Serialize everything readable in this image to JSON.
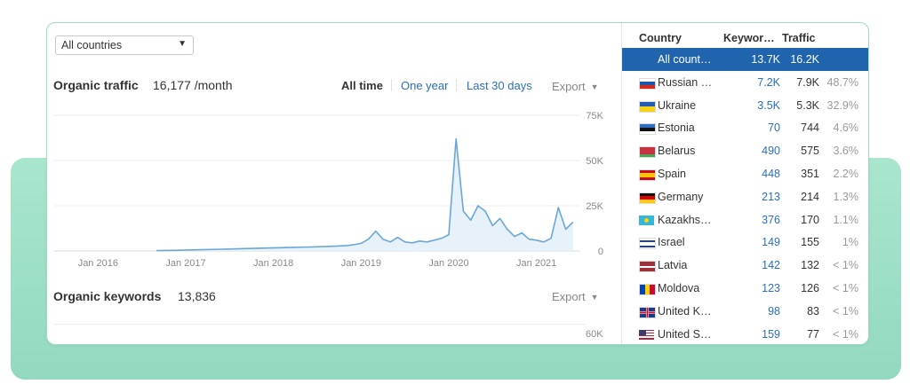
{
  "filter": {
    "country_select": "All countries"
  },
  "organic_traffic": {
    "title": "Organic traffic",
    "value": "16,177 /month",
    "ranges": [
      "All time",
      "One year",
      "Last 30 days"
    ],
    "active_range": "All time",
    "export": "Export"
  },
  "organic_keywords": {
    "title": "Organic keywords",
    "value": "13,836",
    "export": "Export",
    "y_tick_top": "60K"
  },
  "chart_data": {
    "type": "area",
    "x_ticks": [
      "Jan 2016",
      "Jan 2017",
      "Jan 2018",
      "Jan 2019",
      "Jan 2020",
      "Jan 2021"
    ],
    "y_ticks": [
      "75K",
      "50K",
      "25K",
      "0"
    ],
    "ylim": [
      0,
      75000
    ],
    "grid": true,
    "x": [
      "2016-09",
      "2016-12",
      "2017-03",
      "2017-06",
      "2017-09",
      "2017-12",
      "2018-03",
      "2018-06",
      "2018-09",
      "2018-11",
      "2018-12",
      "2019-01",
      "2019-02",
      "2019-03",
      "2019-04",
      "2019-05",
      "2019-06",
      "2019-07",
      "2019-08",
      "2019-09",
      "2019-10",
      "2019-11",
      "2019-12",
      "2020-01",
      "2020-02",
      "2020-03",
      "2020-04",
      "2020-05",
      "2020-06",
      "2020-07",
      "2020-08",
      "2020-09",
      "2020-10",
      "2020-11",
      "2020-12",
      "2021-01",
      "2021-02",
      "2021-03",
      "2021-04",
      "2021-05",
      "2021-06"
    ],
    "series": [
      {
        "values": [
          200,
          400,
          700,
          1000,
          1300,
          1600,
          1900,
          2200,
          2600,
          3000,
          3500,
          4200,
          6500,
          11000,
          6500,
          5000,
          7500,
          5000,
          4500,
          5500,
          5000,
          6000,
          7000,
          9000,
          62000,
          22000,
          17000,
          25000,
          22000,
          14000,
          18000,
          12000,
          8000,
          10000,
          6500,
          6000,
          5000,
          7000,
          24000,
          12000,
          16000
        ]
      }
    ]
  },
  "countries": {
    "headers": {
      "country": "Country",
      "keywords": "Keywor…",
      "traffic": "Traffic"
    },
    "rows": [
      {
        "name": "All count…",
        "keywords": "13.7K",
        "traffic": "16.2K",
        "pct": "",
        "flag": "",
        "selected": true
      },
      {
        "name": "Russian …",
        "keywords": "7.2K",
        "traffic": "7.9K",
        "pct": "48.7%",
        "flag": "russia-flag"
      },
      {
        "name": "Ukraine",
        "keywords": "3.5K",
        "traffic": "5.3K",
        "pct": "32.9%",
        "flag": "ukraine-flag"
      },
      {
        "name": "Estonia",
        "keywords": "70",
        "traffic": "744",
        "pct": "4.6%",
        "flag": "estonia-flag"
      },
      {
        "name": "Belarus",
        "keywords": "490",
        "traffic": "575",
        "pct": "3.6%",
        "flag": "belarus-flag"
      },
      {
        "name": "Spain",
        "keywords": "448",
        "traffic": "351",
        "pct": "2.2%",
        "flag": "spain-flag"
      },
      {
        "name": "Germany",
        "keywords": "213",
        "traffic": "214",
        "pct": "1.3%",
        "flag": "germany-flag"
      },
      {
        "name": "Kazakhs…",
        "keywords": "376",
        "traffic": "170",
        "pct": "1.1%",
        "flag": "kazakhstan-flag"
      },
      {
        "name": "Israel",
        "keywords": "149",
        "traffic": "155",
        "pct": "1%",
        "flag": "israel-flag"
      },
      {
        "name": "Latvia",
        "keywords": "142",
        "traffic": "132",
        "pct": "< 1%",
        "flag": "latvia-flag"
      },
      {
        "name": "Moldova",
        "keywords": "123",
        "traffic": "126",
        "pct": "< 1%",
        "flag": "moldova-flag"
      },
      {
        "name": "United K…",
        "keywords": "98",
        "traffic": "83",
        "pct": "< 1%",
        "flag": "uk-flag"
      },
      {
        "name": "United S…",
        "keywords": "159",
        "traffic": "77",
        "pct": "< 1%",
        "flag": "usa-flag"
      }
    ]
  },
  "colors": {
    "accent": "#2a6ebd",
    "selected_row": "#1f64ad",
    "line": "#6aa7d8",
    "area": "#e6f1fa",
    "background_band": "#a9e6cd"
  }
}
